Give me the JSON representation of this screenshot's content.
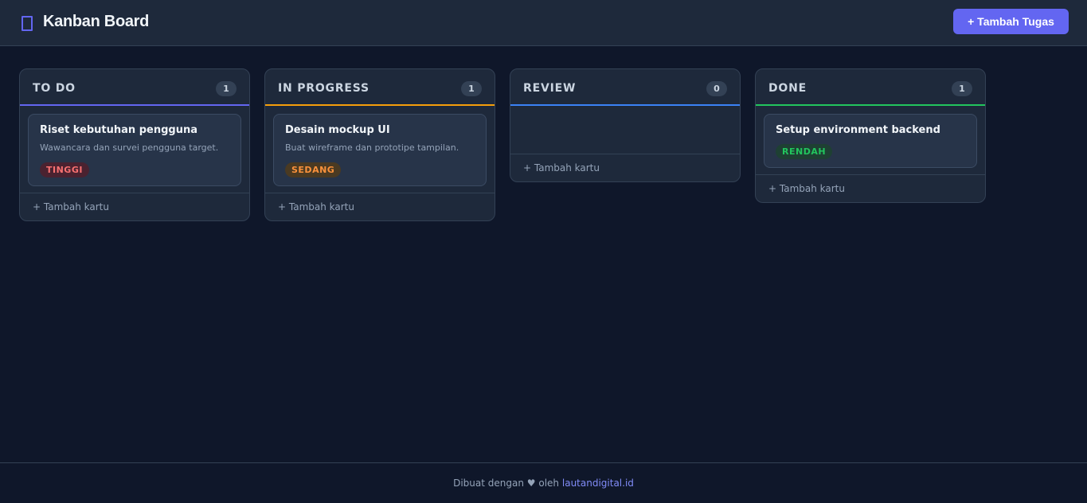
{
  "header": {
    "logo_icon": "clipboard-icon",
    "title": "Kanban Board",
    "add_button_label": "+ Tambah Tugas",
    "accent_color": "#6366f1"
  },
  "columns": [
    {
      "title": "TO DO",
      "count": "1",
      "accent_color": "#6366f1",
      "cards": [
        {
          "title": "Riset kebutuhan pengguna",
          "description": "Wawancara dan survei pengguna target.",
          "priority": "TINGGI"
        }
      ],
      "add_label": "+ Tambah kartu"
    },
    {
      "title": "IN PROGRESS",
      "count": "1",
      "accent_color": "#f59e0b",
      "cards": [
        {
          "title": "Desain mockup UI",
          "description": "Buat wireframe dan prototipe tampilan.",
          "priority": "SEDANG"
        }
      ],
      "add_label": "+ Tambah kartu"
    },
    {
      "title": "REVIEW",
      "count": "0",
      "accent_color": "#3b82f6",
      "cards": [],
      "add_label": "+ Tambah kartu"
    },
    {
      "title": "DONE",
      "count": "1",
      "accent_color": "#22c55e",
      "cards": [
        {
          "title": "Setup environment backend",
          "priority": "RENDAH"
        }
      ],
      "add_label": "+ Tambah kartu"
    }
  ],
  "footer": {
    "text_before": "Dibuat dengan",
    "heart": "♥",
    "text_mid": "oleh",
    "link_text": "lautandigital.id"
  }
}
